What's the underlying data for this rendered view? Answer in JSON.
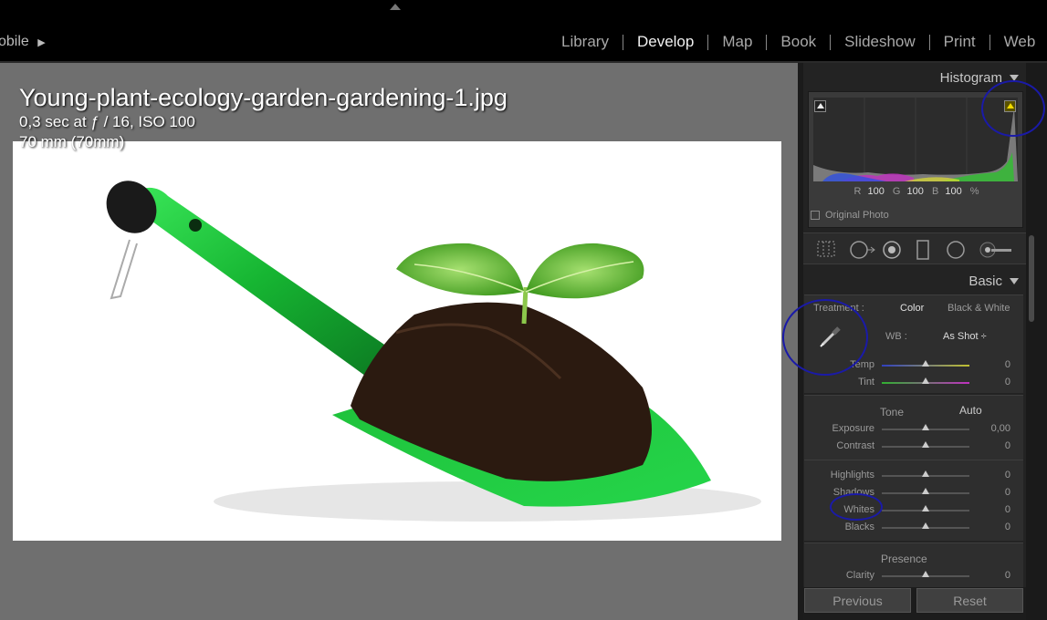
{
  "topbar": {
    "mobile_label": "obile",
    "modules": [
      "Library",
      "Develop",
      "Map",
      "Book",
      "Slideshow",
      "Print",
      "Web"
    ],
    "active_module": "Develop"
  },
  "photo_info": {
    "file_name": "Young-plant-ecology-garden-gardening-1.jpg",
    "exif_line1": "0,3 sec at ƒ / 16, ISO 100",
    "exif_line2": "70 mm (70mm)"
  },
  "histogram": {
    "title": "Histogram",
    "r_label": "R",
    "r_value": "100",
    "g_label": "G",
    "g_value": "100",
    "b_label": "B",
    "b_value": "100",
    "unit": "%",
    "original_photo_label": "Original Photo"
  },
  "tools": [
    "crop-overlay-icon",
    "spot-removal-icon",
    "red-eye-icon",
    "graduated-filter-icon",
    "radial-filter-icon",
    "adjustment-brush-icon"
  ],
  "basic": {
    "title": "Basic",
    "treatment_label": "Treatment :",
    "treatment_color": "Color",
    "treatment_bw": "Black & White",
    "wb_label": "WB :",
    "wb_value": "As Shot ÷",
    "temp_label": "Temp",
    "temp_value": "0",
    "tint_label": "Tint",
    "tint_value": "0",
    "tone_label": "Tone",
    "auto_label": "Auto",
    "exposure_label": "Exposure",
    "exposure_value": "0,00",
    "contrast_label": "Contrast",
    "contrast_value": "0",
    "highlights_label": "Highlights",
    "highlights_value": "0",
    "shadows_label": "Shadows",
    "shadows_value": "0",
    "whites_label": "Whites",
    "whites_value": "0",
    "blacks_label": "Blacks",
    "blacks_value": "0",
    "presence_label": "Presence",
    "clarity_label": "Clarity",
    "clarity_value": "0"
  },
  "buttons": {
    "previous": "Previous",
    "reset": "Reset"
  },
  "colors": {
    "accent_highlight_clip": "#e8d000",
    "annotation": "#1a1aa8",
    "trowel_green": "#1fbf3a"
  }
}
